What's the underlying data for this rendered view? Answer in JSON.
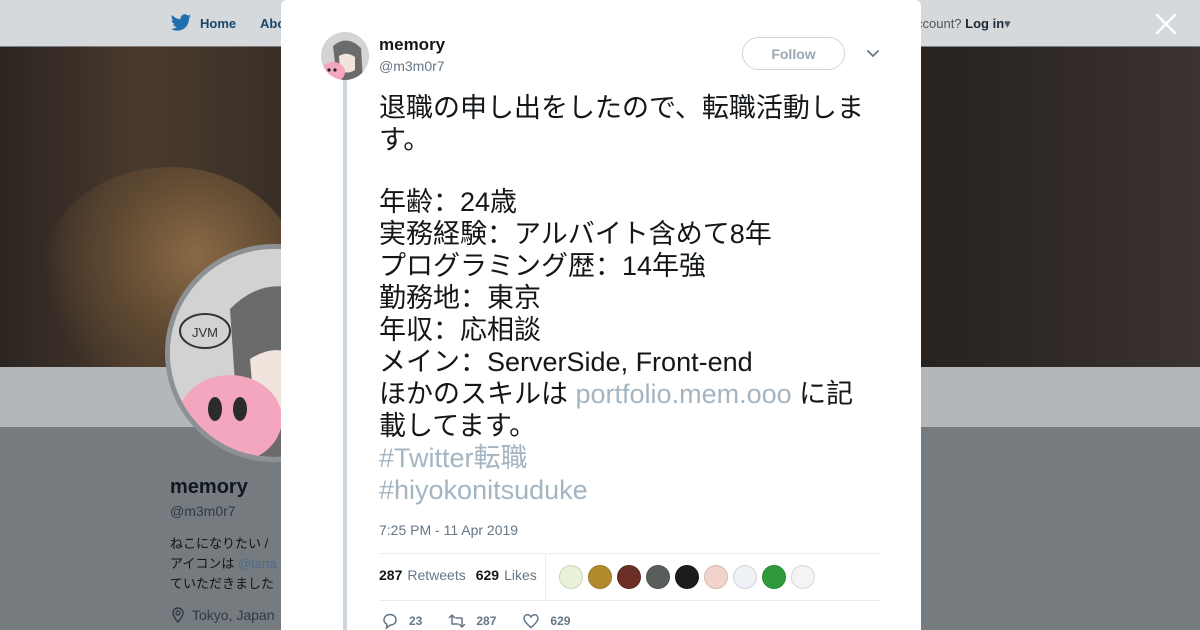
{
  "nav": {
    "home_label": "Home",
    "about_label": "Abo",
    "account_prompt": "ccount?",
    "login_label": "Log in"
  },
  "profile": {
    "name": "memory",
    "handle": "@m3m0r7",
    "bio_line1": "ねこになりたい / ",
    "bio_line2_prefix": "アイコンは ",
    "bio_line2_mention": "@tana",
    "bio_line3": "ていただきました",
    "location": "Tokyo, Japan"
  },
  "tweet": {
    "author_name": "memory",
    "author_handle": "@m3m0r7",
    "follow_label": "Follow",
    "text_lines": [
      "退職の申し出をしたので、転職活動しま",
      "す。",
      "",
      "年齢：24歳",
      "実務経験：アルバイト含めて8年",
      "プログラミング歴：14年強",
      "勤務地：東京",
      "年収：応相談",
      "メイン：ServerSide, Front-end"
    ],
    "skills_prefix": "ほかのスキルは ",
    "skills_link": "portfolio.mem.ooo",
    "skills_suffix": " に記",
    "skills_line2": "載してます。",
    "hashtag1": "#Twitter転職",
    "hashtag2": "#hiyokonitsuduke",
    "timestamp": "7:25 PM - 11 Apr 2019",
    "retweets_count": "287",
    "retweets_label": "Retweets",
    "likes_count": "629",
    "likes_label": "Likes",
    "reply_count": "23",
    "retweet_action_count": "287",
    "like_action_count": "629"
  },
  "likers": [
    {
      "icon": "liker-avatar-1",
      "color": "#e8f2d8"
    },
    {
      "icon": "liker-avatar-2",
      "color": "#b08a2c"
    },
    {
      "icon": "liker-avatar-3",
      "color": "#6b2f25"
    },
    {
      "icon": "liker-avatar-4",
      "color": "#5a5e5a"
    },
    {
      "icon": "liker-avatar-5",
      "color": "#1c1c1c"
    },
    {
      "icon": "liker-avatar-6",
      "color": "#f2d3cc"
    },
    {
      "icon": "liker-avatar-7",
      "color": "#eef2f6"
    },
    {
      "icon": "liker-avatar-8",
      "color": "#2f9a3c"
    },
    {
      "icon": "liker-avatar-9",
      "color": "#f4f4f4"
    }
  ],
  "colors": {
    "twitter_blue": "#1da1f2",
    "link": "#a4b5c2",
    "text": "#14171a",
    "secondary": "#657786"
  }
}
